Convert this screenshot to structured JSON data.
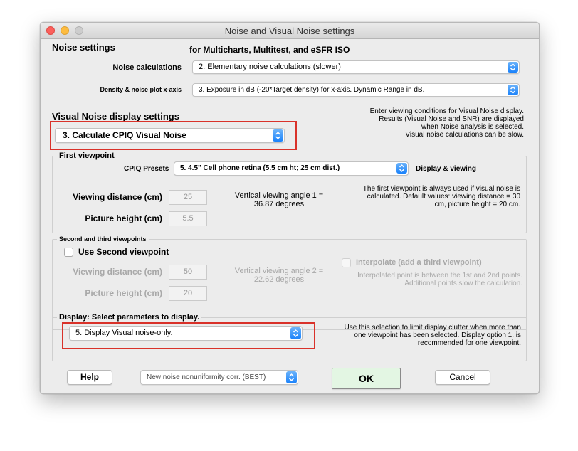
{
  "window": {
    "title": "Noise and Visual Noise settings"
  },
  "noise_settings": {
    "title": "Noise settings",
    "subtitle": "for Multicharts, Multitest, and eSFR ISO",
    "calc_label": "Noise calculations",
    "calc_value": "2. Elementary noise calculations (slower)",
    "density_label": "Density & noise plot x-axis",
    "density_value": "3. Exposure in dB (-20*Target density) for x-axis.   Dynamic Range in dB."
  },
  "visual_noise": {
    "title": "Visual Noise display settings",
    "select_value": "3.  Calculate CPIQ Visual Noise",
    "help_lines": [
      "Enter viewing conditions for Visual Noise display.",
      "Results (Visual Noise and SNR) are displayed",
      "when Noise analysis is selected.",
      "Visual noise calculations can be slow."
    ]
  },
  "first_viewpoint": {
    "group_label": "First viewpoint",
    "presets_label": "CPIQ Presets",
    "presets_value": "5. 4.5\" Cell phone retina (5.5 cm ht; 25 cm dist.)",
    "display_viewing": "Display & viewing",
    "viewing_distance_label": "Viewing distance (cm)",
    "viewing_distance_value": "25",
    "picture_height_label": "Picture height (cm)",
    "picture_height_value": "5.5",
    "angle_line1": "Vertical viewing angle 1 =",
    "angle_line2": "36.87 degrees",
    "note_lines": [
      "The first viewpoint is always used if visual noise is",
      "calculated. Default values: viewing distance = 30",
      "cm,  picture height = 20 cm."
    ]
  },
  "second_viewpoint": {
    "group_label": "Second and third viewpoints",
    "use_second_label": "Use Second viewpoint",
    "viewing_distance_label": "Viewing distance (cm)",
    "viewing_distance_value": "50",
    "picture_height_label": "Picture height (cm)",
    "picture_height_value": "20",
    "angle_line1": "Vertical viewing angle 2 =",
    "angle_line2": "22.62 degrees",
    "interpolate_label": "Interpolate (add a third viewpoint)",
    "interp_note_lines": [
      "Interpolated point is between the 1st and 2nd points.",
      "Additional points slow the calculation."
    ]
  },
  "display": {
    "group_label": "Display:  Select parameters to display.",
    "select_value": "5.  Display Visual noise-only.",
    "note_lines": [
      "Use this selection to limit display clutter when more than",
      "one viewpoint has been selected. Display option 1. is",
      "recommended for one viewpoint."
    ]
  },
  "footer": {
    "help_label": "Help",
    "nonuniformity_value": "New noise nonuniformity corr. (BEST)",
    "ok_label": "OK",
    "cancel_label": "Cancel"
  },
  "colors": {
    "highlight_red": "#d9322a",
    "ok_green": "#e3f6e3",
    "select_blue": "#1a82fb"
  }
}
